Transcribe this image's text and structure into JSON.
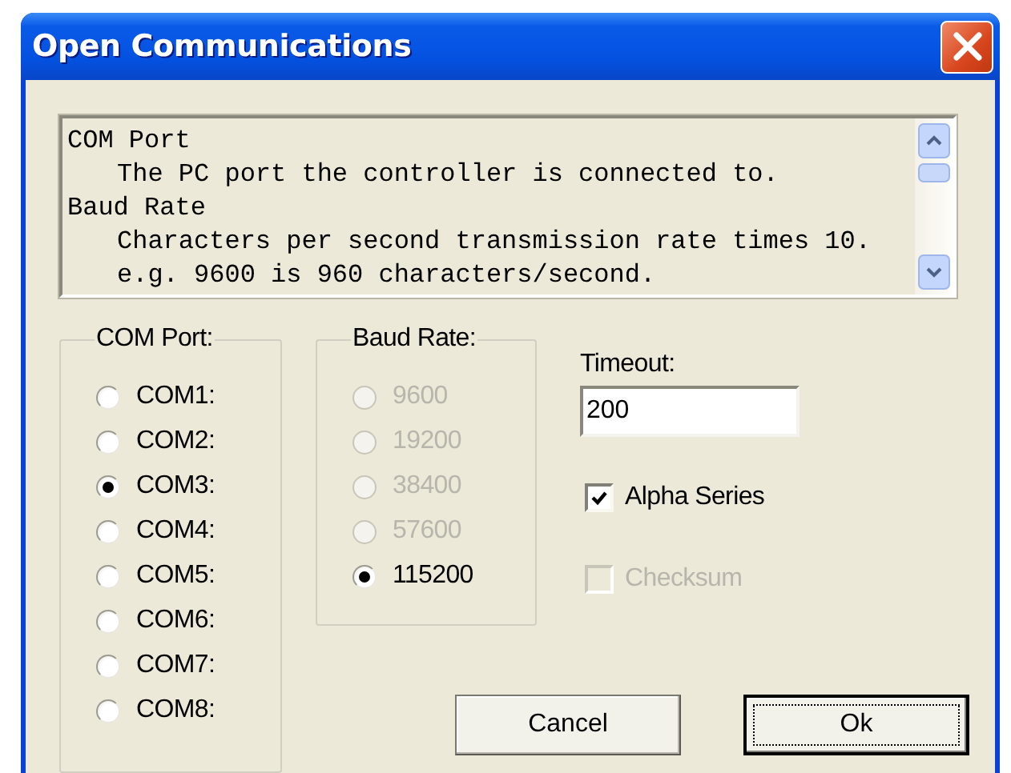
{
  "window": {
    "title": "Open Communications"
  },
  "help_text": {
    "lines": [
      {
        "kind": "heading",
        "text": "COM Port"
      },
      {
        "kind": "body",
        "text": "The PC port the controller is connected to."
      },
      {
        "kind": "heading",
        "text": "Baud Rate"
      },
      {
        "kind": "body",
        "text": "Characters per second transmission rate times 10."
      },
      {
        "kind": "body",
        "text": "e.g. 9600 is 960 characters/second."
      }
    ]
  },
  "com_port": {
    "label": "COM Port:",
    "options": [
      {
        "label": "COM1:",
        "selected": false,
        "disabled": false
      },
      {
        "label": "COM2:",
        "selected": false,
        "disabled": false
      },
      {
        "label": "COM3:",
        "selected": true,
        "disabled": false
      },
      {
        "label": "COM4:",
        "selected": false,
        "disabled": false
      },
      {
        "label": "COM5:",
        "selected": false,
        "disabled": false
      },
      {
        "label": "COM6:",
        "selected": false,
        "disabled": false
      },
      {
        "label": "COM7:",
        "selected": false,
        "disabled": false
      },
      {
        "label": "COM8:",
        "selected": false,
        "disabled": false
      }
    ]
  },
  "baud_rate": {
    "label": "Baud Rate:",
    "options": [
      {
        "label": "9600",
        "selected": false,
        "disabled": true
      },
      {
        "label": "19200",
        "selected": false,
        "disabled": true
      },
      {
        "label": "38400",
        "selected": false,
        "disabled": true
      },
      {
        "label": "57600",
        "selected": false,
        "disabled": true
      },
      {
        "label": "115200",
        "selected": true,
        "disabled": false
      }
    ]
  },
  "timeout": {
    "label": "Timeout:",
    "value": "200"
  },
  "checkboxes": [
    {
      "label": "Alpha Series",
      "checked": true,
      "disabled": false
    },
    {
      "label": "Checksum",
      "checked": false,
      "disabled": true
    }
  ],
  "buttons": [
    {
      "label": "Cancel",
      "default": false
    },
    {
      "label": "Ok",
      "default": true
    }
  ]
}
